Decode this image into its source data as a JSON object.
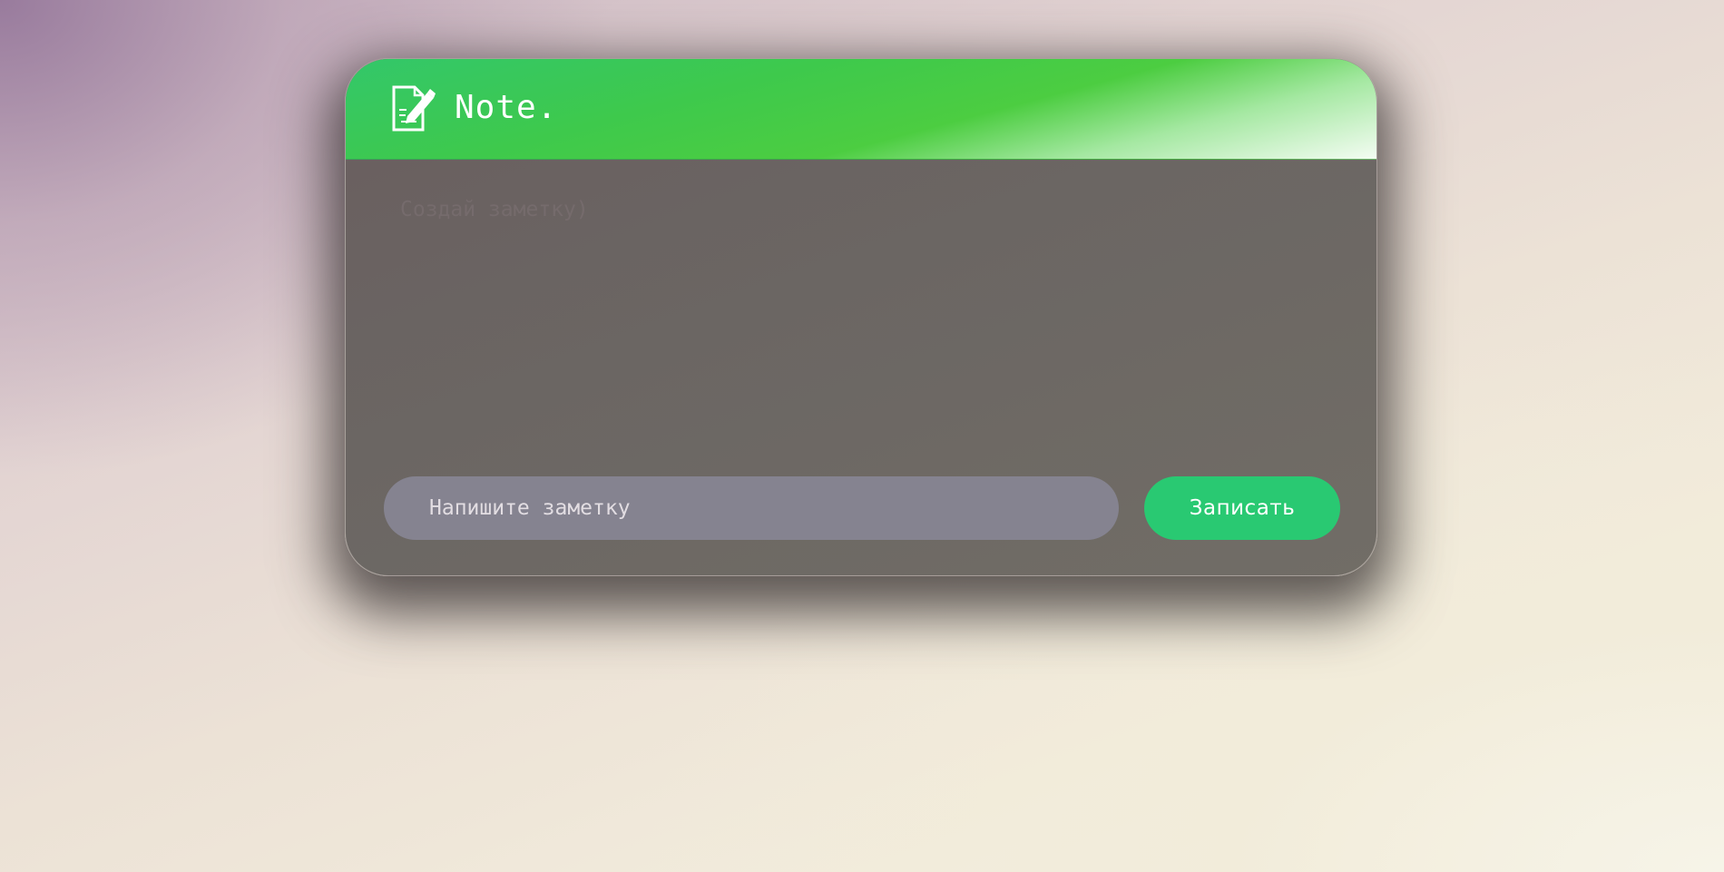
{
  "app": {
    "title": "Note.",
    "logo_icon": "note-edit-icon",
    "accent_color": "#3ec94c"
  },
  "notes": {
    "empty_placeholder": "Создай заметку)"
  },
  "composer": {
    "input_placeholder": "Напишите заметку",
    "input_value": "",
    "submit_label": "Записать",
    "submit_color": "#29c972"
  }
}
